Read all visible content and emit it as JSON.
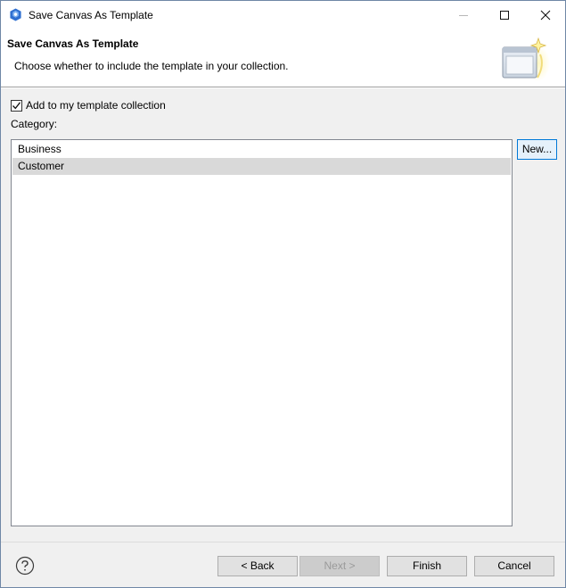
{
  "window": {
    "title": "Save Canvas As Template",
    "icon": "app-hexagon-icon"
  },
  "banner": {
    "title": "Save Canvas As Template",
    "message": "Choose whether to include the template in your collection.",
    "graphic": "template-window-sparkle-icon"
  },
  "form": {
    "add_to_collection_label": "Add to my template collection",
    "add_to_collection_checked": true,
    "category_label": "Category:",
    "categories": [
      {
        "label": "Business",
        "selected": false
      },
      {
        "label": "Customer",
        "selected": true
      }
    ],
    "new_button_label": "New..."
  },
  "footer": {
    "help_icon": "question-circle-icon",
    "back_label": "< Back",
    "next_label": "Next >",
    "next_disabled": true,
    "finish_label": "Finish",
    "cancel_label": "Cancel"
  },
  "colors": {
    "selection": "#d9d9d9",
    "focus_border": "#0078d7",
    "content_bg": "#f0f0f0"
  }
}
